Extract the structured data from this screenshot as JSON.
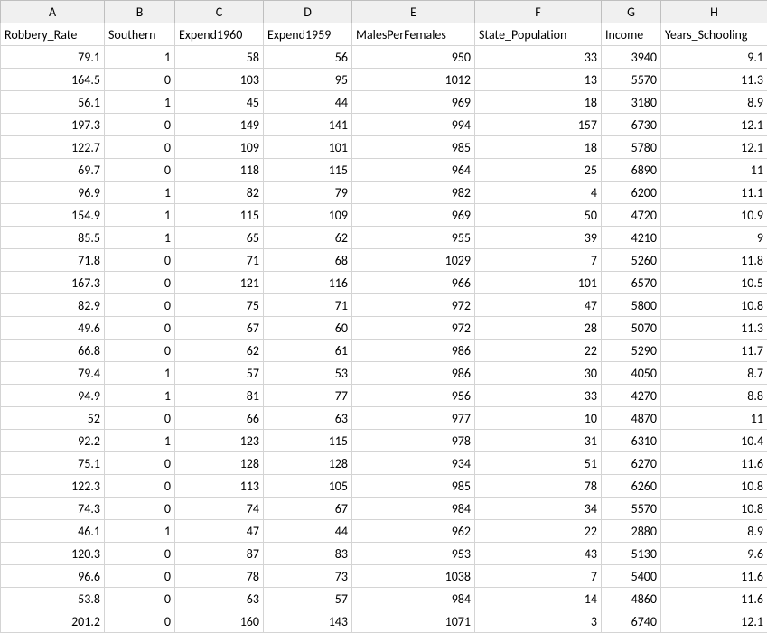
{
  "columns": [
    "A",
    "B",
    "C",
    "D",
    "E",
    "F",
    "G",
    "H"
  ],
  "headers": [
    "Robbery_Rate",
    "Southern",
    "Expend1960",
    "Expend1959",
    "MalesPerFemales",
    "State_Population",
    "Income",
    "Years_Schooling"
  ],
  "rows": [
    [
      "79.1",
      "1",
      "58",
      "56",
      "950",
      "33",
      "3940",
      "9.1"
    ],
    [
      "164.5",
      "0",
      "103",
      "95",
      "1012",
      "13",
      "5570",
      "11.3"
    ],
    [
      "56.1",
      "1",
      "45",
      "44",
      "969",
      "18",
      "3180",
      "8.9"
    ],
    [
      "197.3",
      "0",
      "149",
      "141",
      "994",
      "157",
      "6730",
      "12.1"
    ],
    [
      "122.7",
      "0",
      "109",
      "101",
      "985",
      "18",
      "5780",
      "12.1"
    ],
    [
      "69.7",
      "0",
      "118",
      "115",
      "964",
      "25",
      "6890",
      "11"
    ],
    [
      "96.9",
      "1",
      "82",
      "79",
      "982",
      "4",
      "6200",
      "11.1"
    ],
    [
      "154.9",
      "1",
      "115",
      "109",
      "969",
      "50",
      "4720",
      "10.9"
    ],
    [
      "85.5",
      "1",
      "65",
      "62",
      "955",
      "39",
      "4210",
      "9"
    ],
    [
      "71.8",
      "0",
      "71",
      "68",
      "1029",
      "7",
      "5260",
      "11.8"
    ],
    [
      "167.3",
      "0",
      "121",
      "116",
      "966",
      "101",
      "6570",
      "10.5"
    ],
    [
      "82.9",
      "0",
      "75",
      "71",
      "972",
      "47",
      "5800",
      "10.8"
    ],
    [
      "49.6",
      "0",
      "67",
      "60",
      "972",
      "28",
      "5070",
      "11.3"
    ],
    [
      "66.8",
      "0",
      "62",
      "61",
      "986",
      "22",
      "5290",
      "11.7"
    ],
    [
      "79.4",
      "1",
      "57",
      "53",
      "986",
      "30",
      "4050",
      "8.7"
    ],
    [
      "94.9",
      "1",
      "81",
      "77",
      "956",
      "33",
      "4270",
      "8.8"
    ],
    [
      "52",
      "0",
      "66",
      "63",
      "977",
      "10",
      "4870",
      "11"
    ],
    [
      "92.2",
      "1",
      "123",
      "115",
      "978",
      "31",
      "6310",
      "10.4"
    ],
    [
      "75.1",
      "0",
      "128",
      "128",
      "934",
      "51",
      "6270",
      "11.6"
    ],
    [
      "122.3",
      "0",
      "113",
      "105",
      "985",
      "78",
      "6260",
      "10.8"
    ],
    [
      "74.3",
      "0",
      "74",
      "67",
      "984",
      "34",
      "5570",
      "10.8"
    ],
    [
      "46.1",
      "1",
      "47",
      "44",
      "962",
      "22",
      "2880",
      "8.9"
    ],
    [
      "120.3",
      "0",
      "87",
      "83",
      "953",
      "43",
      "5130",
      "9.6"
    ],
    [
      "96.6",
      "0",
      "78",
      "73",
      "1038",
      "7",
      "5400",
      "11.6"
    ],
    [
      "53.8",
      "0",
      "63",
      "57",
      "984",
      "14",
      "4860",
      "11.6"
    ],
    [
      "201.2",
      "0",
      "160",
      "143",
      "1071",
      "3",
      "6740",
      "12.1"
    ]
  ]
}
